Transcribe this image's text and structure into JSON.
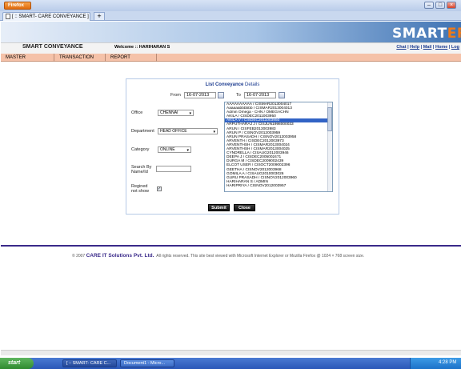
{
  "browser": {
    "menu_button": "Firefox",
    "tab_title": "[ :: SMART- CARE CONVEYANCE ]",
    "new_tab": "+"
  },
  "header": {
    "logo_main": "SMART",
    "logo_accent": "ERP",
    "app_title": "SMART CONVEYANCE",
    "welcome": "Welcome :: HARIHARAN S",
    "links": [
      "Chat",
      "Help",
      "Mail",
      "Home",
      "Log"
    ]
  },
  "menu": [
    "MASTER",
    "TRANSACTION",
    "REPORT"
  ],
  "form": {
    "title": "List Conveyance",
    "title_suffix": "Details",
    "from_label": "From",
    "from_value": "16-07-2013",
    "to_label": "To",
    "to_value": "16-07-2013",
    "office_label": "Office",
    "office_value": "CHENNAI",
    "department_label": "Department",
    "department_value": "HEAD OFFICE",
    "category_label": "Category",
    "category_value": "ONLINE",
    "search_label_1": "Search By",
    "search_label_2": "Name/Id",
    "resigned_label_1": "Regined",
    "resigned_label_2": "not show",
    "resigned_checked": "✓",
    "submit_label": "Submit",
    "close_label": "Close",
    "selected_index": 4,
    "users": [
      "AAAAAAAAAA / CISMAR2013004017",
      "Aaaaaabbbbbb / CISMAR2013004013",
      "Admin Omega - CHN / OMEGACHN",
      "AKILA / CISDEC2011003950",
      "AKILA V / CISDEC2011003950",
      "ARPUTHARAJ J / CISJUN1998000033",
      "ARUN / CISFEB2013003983",
      "ARUN P / CISNOV2012003959",
      "ARUN PRASADH / CISNOV2012003958",
      "ARVENTH / CISDEC2012003973",
      "ARVENTHSH / CISMAR2013004024",
      "ARVENTHSH / CISMAR2013004025",
      "CYNDRELLA / CISAUG2012003946",
      "DEEPA J / CISDEC2005002471",
      "DURGA M / CISDEC2009002439",
      "ELCOT USER / CISOCT2009002396",
      "GEETHA / CISNOV2012003968",
      "GOMILA A / CISAUG2010003026",
      "GURU PRASADH / CISNOV2012003960",
      "HARIHARAN S / ADMIN",
      "HARIPRIYA / CISNOV2012003957"
    ]
  },
  "footer": {
    "copyright": "© 2007",
    "company": "CARE IT Solutions Pvt. Ltd.",
    "notice": "All rights reserved.   This site best viewed with Microsoft Internet Explorer or Mozilla Firefox @ 1024 × 768 screen size."
  },
  "taskbar": {
    "start": "start",
    "tasks": [
      "[ :: SMART- CARE C...",
      "Document1 - Micro..."
    ],
    "clock": "4:28 PM"
  }
}
